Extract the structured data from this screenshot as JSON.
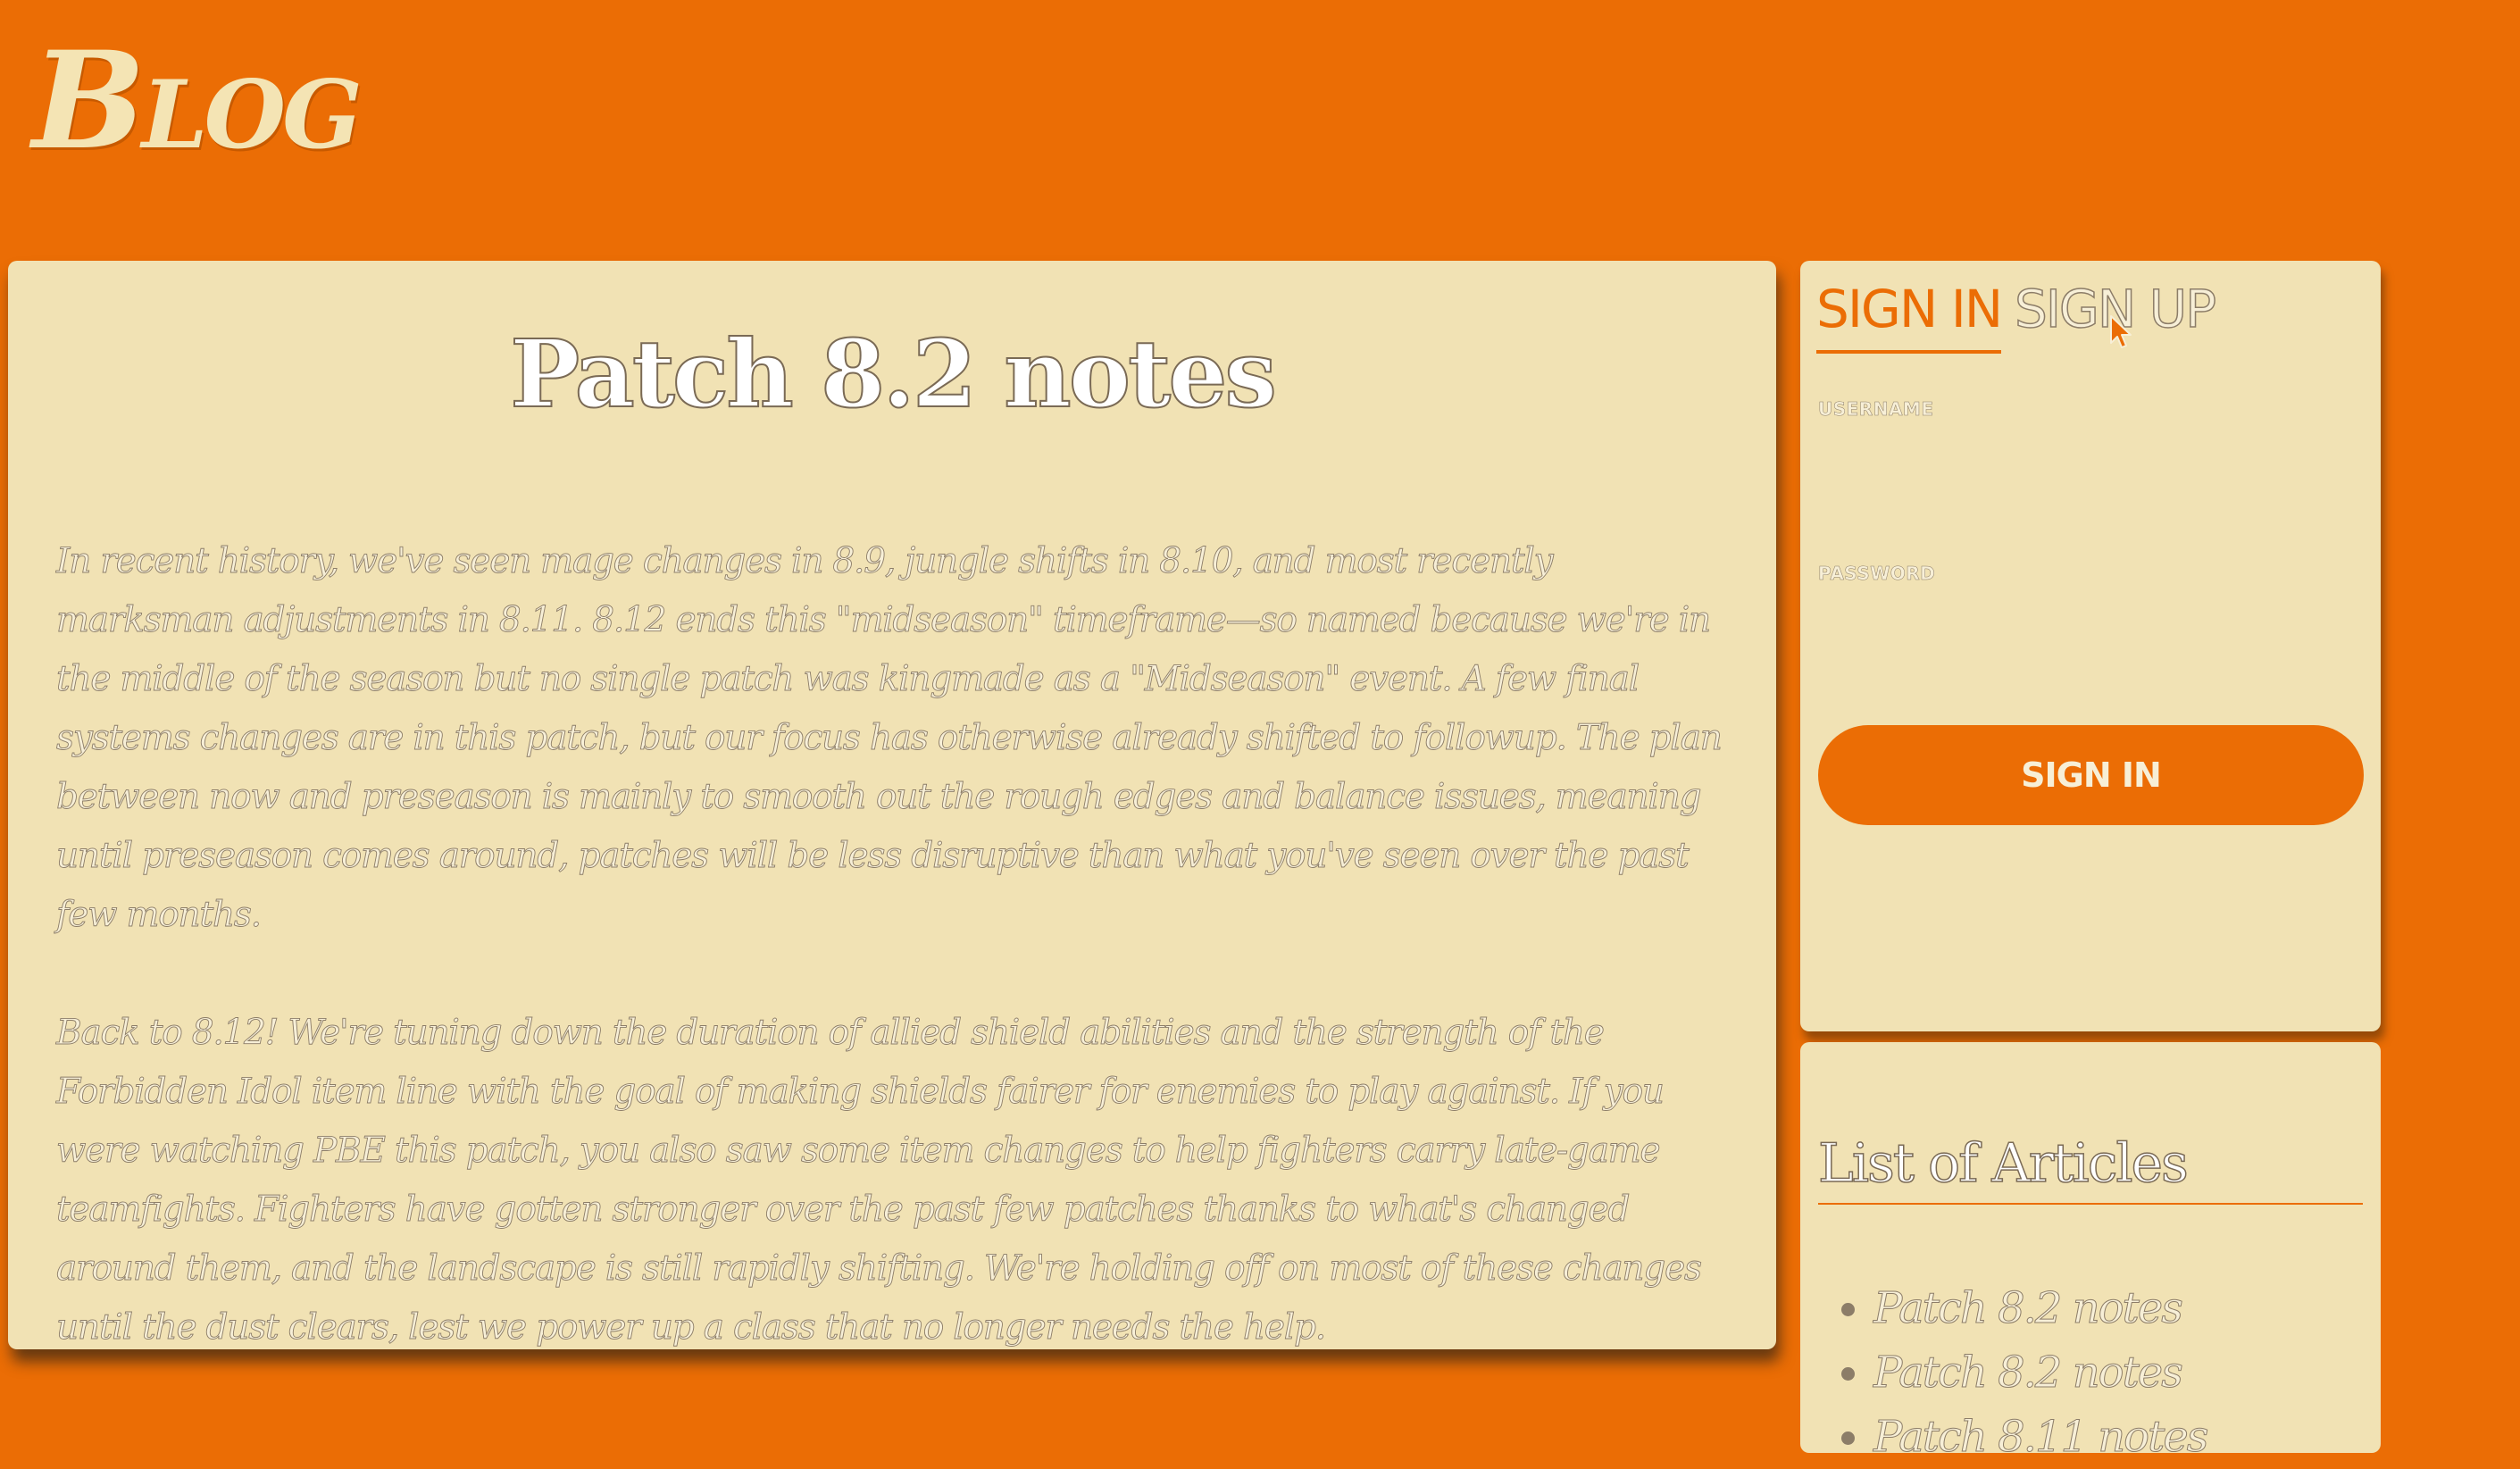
{
  "header": {
    "logo": "Blog"
  },
  "article": {
    "title": "Patch 8.2 notes",
    "paragraphs": [
      "In recent history, we've seen mage changes in 8.9, jungle shifts in 8.10, and most recently marksman adjustments in 8.11. 8.12 ends this \"midseason\" timeframe—so named because we're in the middle of the season but no single patch was kingmade as a \"Midseason\" event. A few final systems changes are in this patch, but our focus has otherwise already shifted to followup. The plan between now and preseason is mainly to smooth out the rough edges and balance issues, meaning until preseason comes around, patches will be less disruptive than what you've seen over the past few months.",
      "Back to 8.12! We're tuning down the duration of allied shield abilities and the strength of the Forbidden Idol item line with the goal of making shields fairer for enemies to play against. If you were watching PBE this patch, you also saw some item changes to help fighters carry late-game teamfights. Fighters have gotten stronger over the past few patches thanks to what's changed around them, and the landscape is still rapidly shifting. We're holding off on most of these changes until the dust clears, lest we power up a class that no longer needs the help."
    ]
  },
  "auth": {
    "tab_signin": "SIGN IN",
    "tab_signup": "SIGN UP",
    "username_label": "USERNAME",
    "username_value": "",
    "password_label": "PASSWORD",
    "password_value": "",
    "submit_label": "SIGN IN"
  },
  "articles_list": {
    "title": "List of Articles",
    "items": [
      {
        "label": "Patch 8.2 notes"
      },
      {
        "label": "Patch 8.2 notes"
      },
      {
        "label": "Patch 8.11 notes"
      }
    ]
  },
  "colors": {
    "background": "#eb6d05",
    "card": "#f1e2b4",
    "accent": "#eb6d05",
    "text_light": "#f7efd7"
  },
  "icons": {
    "cursor": "pointer-cursor-icon"
  }
}
